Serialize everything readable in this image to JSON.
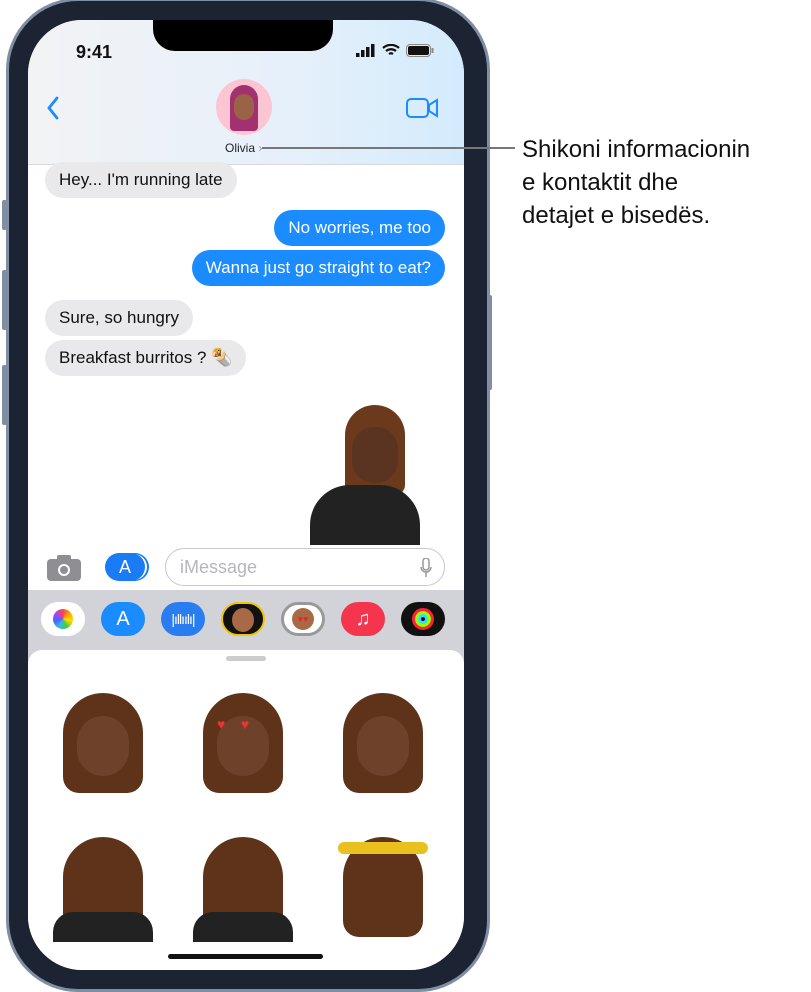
{
  "status_bar": {
    "time": "9:41"
  },
  "header": {
    "contact_name": "Olivia",
    "back_icon": "chevron-left-icon",
    "video_icon": "video-camera-icon"
  },
  "messages": [
    {
      "from": "them",
      "text": "Hey... I'm running late"
    },
    {
      "from": "me",
      "text": "No worries, me too"
    },
    {
      "from": "me",
      "text": "Wanna just go straight to eat?"
    },
    {
      "from": "them",
      "text": "Sure, so hungry"
    },
    {
      "from": "them",
      "text": "Breakfast burritos ? 🌯"
    }
  ],
  "composer": {
    "placeholder": "iMessage"
  },
  "app_drawer": [
    "Photos",
    "App Store",
    "Audio",
    "Memoji",
    "Memoji Stickers",
    "Music",
    "Activity"
  ],
  "colors": {
    "accent": "#1a8cff",
    "bubble_gray": "#e9e9eb",
    "tray": "#d1d3d9"
  },
  "callout": {
    "text": "Shikoni informacionin e kontaktit dhe detajet e bisedës.",
    "line1": "Shikoni informacionin",
    "line2": "e kontaktit dhe",
    "line3": "detajet e bisedës."
  }
}
